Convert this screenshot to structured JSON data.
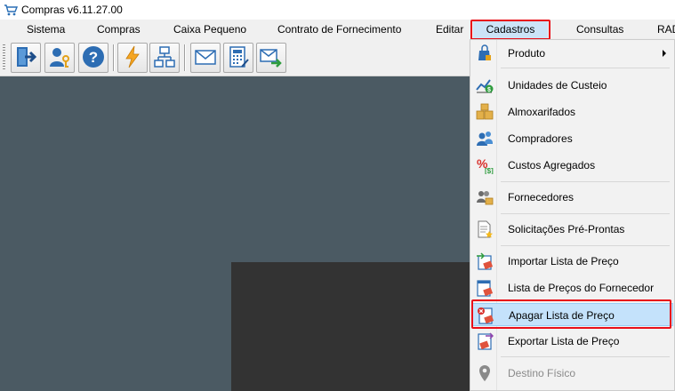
{
  "window": {
    "title": "Compras v6.11.27.00",
    "icon": "cart-icon"
  },
  "menubar": {
    "items": [
      "Sistema",
      "Compras",
      "Caixa Pequeno",
      "Contrato de Fornecimento",
      "Editar",
      "Cadastros",
      "Consultas",
      "RAD"
    ],
    "active": "Cadastros"
  },
  "toolbar": {
    "buttons": [
      "exit-icon",
      "user-key-icon",
      "help-icon",
      "lightning-icon",
      "org-chart-icon",
      "envelope-icon",
      "calculator-icon",
      "send-mail-icon"
    ]
  },
  "cadastros_menu": {
    "items": [
      {
        "label": "Produto",
        "icon": "product-icon",
        "submenu": true
      },
      {
        "label": "Unidades de Custeio",
        "icon": "chart-coin-icon"
      },
      {
        "label": "Almoxarifados",
        "icon": "boxes-icon"
      },
      {
        "label": "Compradores",
        "icon": "users-icon"
      },
      {
        "label": "Custos Agregados",
        "icon": "percent-icon"
      },
      {
        "label": "Fornecedores",
        "icon": "supplier-icon"
      },
      {
        "label": "Solicitações Pré-Prontas",
        "icon": "document-star-icon"
      },
      {
        "label": "Importar Lista de Preço",
        "icon": "import-price-list-icon"
      },
      {
        "label": "Lista de Preços do Fornecedor",
        "icon": "price-list-icon"
      },
      {
        "label": "Apagar Lista de Preço",
        "icon": "delete-price-list-icon",
        "highlighted": true
      },
      {
        "label": "Exportar Lista de Preço",
        "icon": "export-price-list-icon"
      },
      {
        "label": "Destino Físico",
        "icon": "location-pin-icon",
        "disabled": true
      }
    ]
  },
  "colors": {
    "highlight_outline": "#e8101a",
    "menu_hover": "#c4e2fb",
    "workspace": "#4b5a63",
    "dark_panel": "#333333"
  }
}
